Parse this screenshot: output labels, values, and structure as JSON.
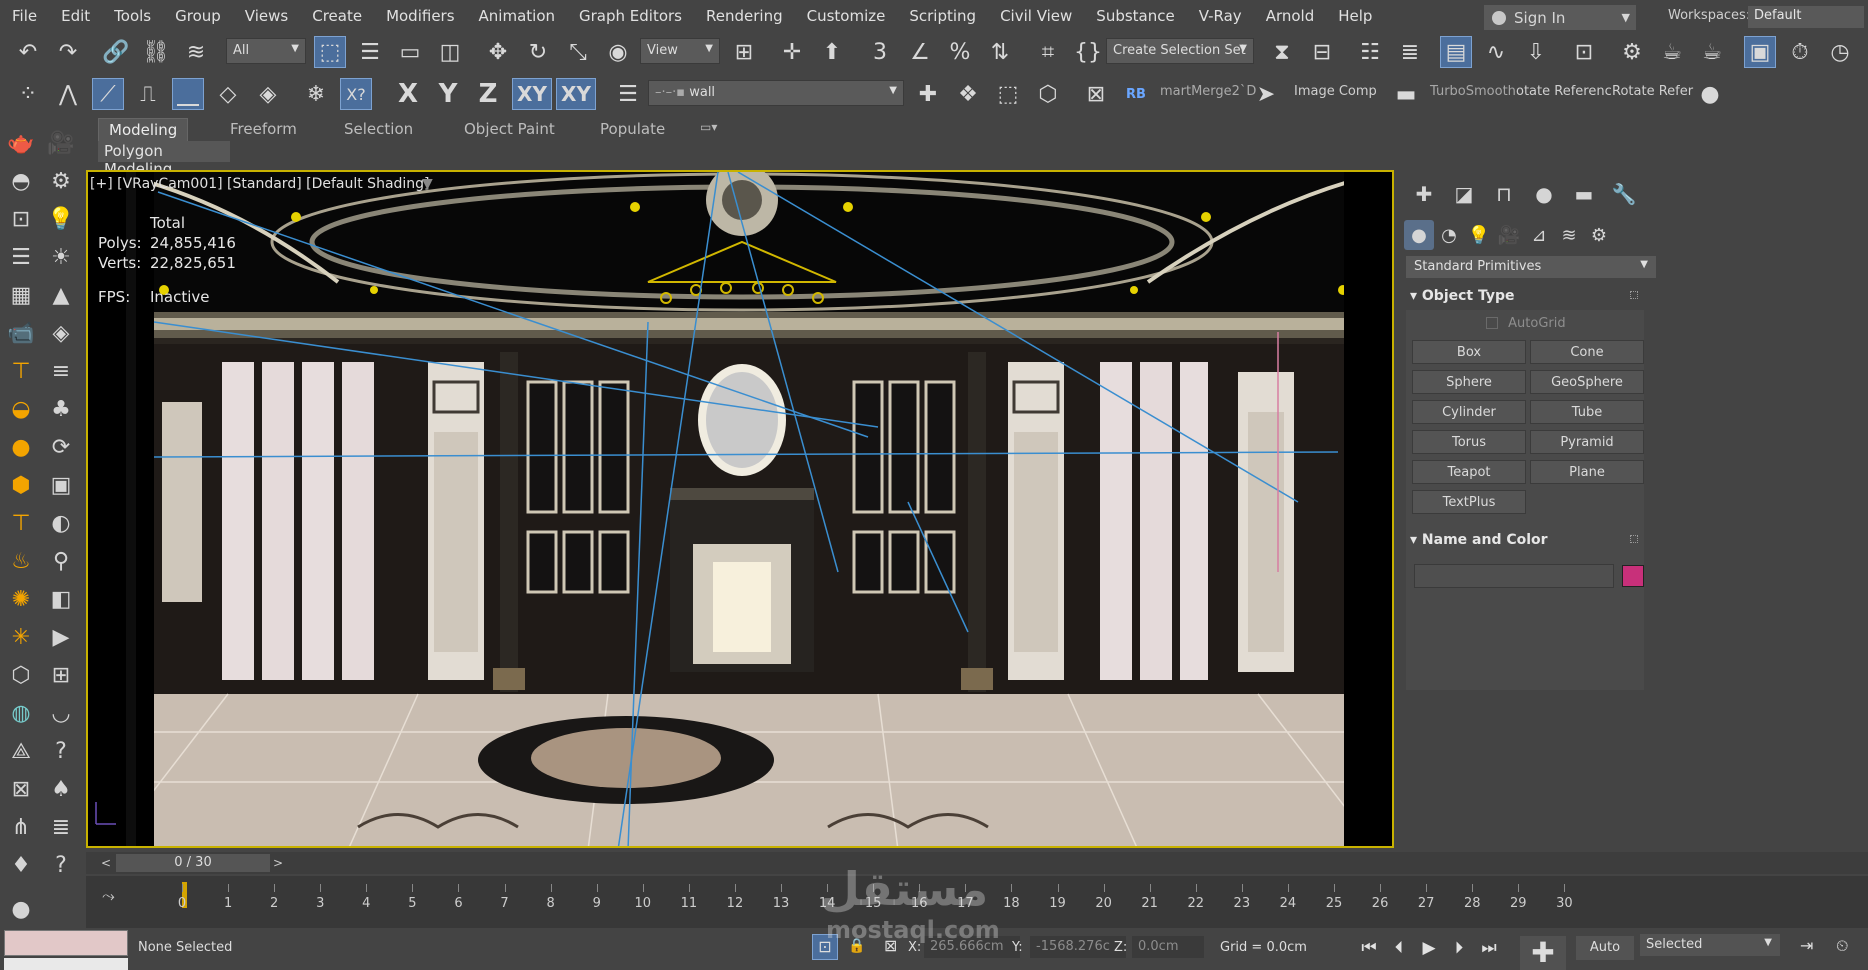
{
  "menu": {
    "items": [
      "File",
      "Edit",
      "Tools",
      "Group",
      "Views",
      "Create",
      "Modifiers",
      "Animation",
      "Graph Editors",
      "Rendering",
      "Customize",
      "Scripting",
      "Civil View",
      "Substance",
      "V-Ray",
      "Arnold",
      "Help"
    ],
    "sign_in": "Sign In",
    "workspaces_label": "Workspaces:",
    "workspace_value": "Default"
  },
  "toolbar1": {
    "filter_value": "All",
    "ref_coord_value": "View",
    "selection_set_placeholder": "Create Selection Set",
    "snap_angle_badge": "3"
  },
  "toolbar2": {
    "axes": [
      "X",
      "Y",
      "Z",
      "XY",
      "XY"
    ],
    "layer_value": "wall",
    "script_btn_rb": "RB",
    "smartmerge": "martMerge2`D",
    "image_comp": "Image Comp",
    "turbosmooth": "TurboSmooth",
    "rotate_ref_1": "otate Referenc",
    "rotate_ref_2": "Rotate Refer"
  },
  "ribbon": {
    "tabs": [
      "Modeling",
      "Freeform",
      "Selection",
      "Object Paint",
      "Populate"
    ],
    "active_tab": "Modeling",
    "sub_label": "Polygon Modeling"
  },
  "viewport": {
    "label": "[+] [VRayCam001] [Standard] [Default Shading]",
    "stats": {
      "total_label": "Total",
      "polys_label": "Polys:",
      "polys_value": "24,855,416",
      "verts_label": "Verts:",
      "verts_value": "22,825,651",
      "fps_label": "FPS:",
      "fps_value": "Inactive"
    }
  },
  "command_panel": {
    "category_value": "Standard Primitives",
    "object_type_title": "Object Type",
    "autogrid_label": "AutoGrid",
    "primitives": [
      "Box",
      "Cone",
      "Sphere",
      "GeoSphere",
      "Cylinder",
      "Tube",
      "Torus",
      "Pyramid",
      "Teapot",
      "Plane",
      "TextPlus"
    ],
    "name_color_title": "Name and Color",
    "swatch_color": "#c8307a"
  },
  "timeline": {
    "frame_display": "0 / 30",
    "ticks": [
      "0",
      "1",
      "2",
      "3",
      "4",
      "5",
      "6",
      "7",
      "8",
      "9",
      "10",
      "11",
      "12",
      "13",
      "14",
      "15",
      "16",
      "17",
      "18",
      "19",
      "20",
      "21",
      "22",
      "23",
      "24",
      "25",
      "26",
      "27",
      "28",
      "29",
      "30"
    ]
  },
  "status": {
    "selection": "None Selected",
    "x_label": "X:",
    "x_value": "265.666cm",
    "y_label": "Y:",
    "y_value": "-1568.276c",
    "z_label": "Z:",
    "z_value": "0.0cm",
    "grid": "Grid = 0.0cm",
    "auto_key": "Auto",
    "key_mode": "Selected"
  },
  "watermark": {
    "arabic": "مستقل",
    "latin": "mostaql.com"
  },
  "colors": {
    "ui_bg": "#444444",
    "viewport_border": "#c8b200",
    "active_tool": "#4b6e9c",
    "timeline_cursor": "#d3a400"
  }
}
